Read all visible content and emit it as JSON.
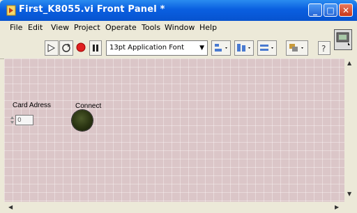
{
  "window": {
    "title": "First_K8055.vi Front Panel *",
    "controls": [
      "_",
      "□",
      "✕"
    ]
  },
  "menubar": {
    "items": [
      "File",
      "Edit",
      "View",
      "Project",
      "Operate",
      "Tools",
      "Window",
      "Help"
    ]
  },
  "toolbar": {
    "font_label": "13pt Application Font"
  },
  "panel": {
    "card_address_label": "Card Adress",
    "card_address_value": "0",
    "connect_label": "Connect",
    "connect_led_state": "off"
  },
  "scrollbars": {
    "up_arrow": "▲",
    "down_arrow": "▼",
    "left_arrow": "◀",
    "right_arrow": "▶"
  }
}
